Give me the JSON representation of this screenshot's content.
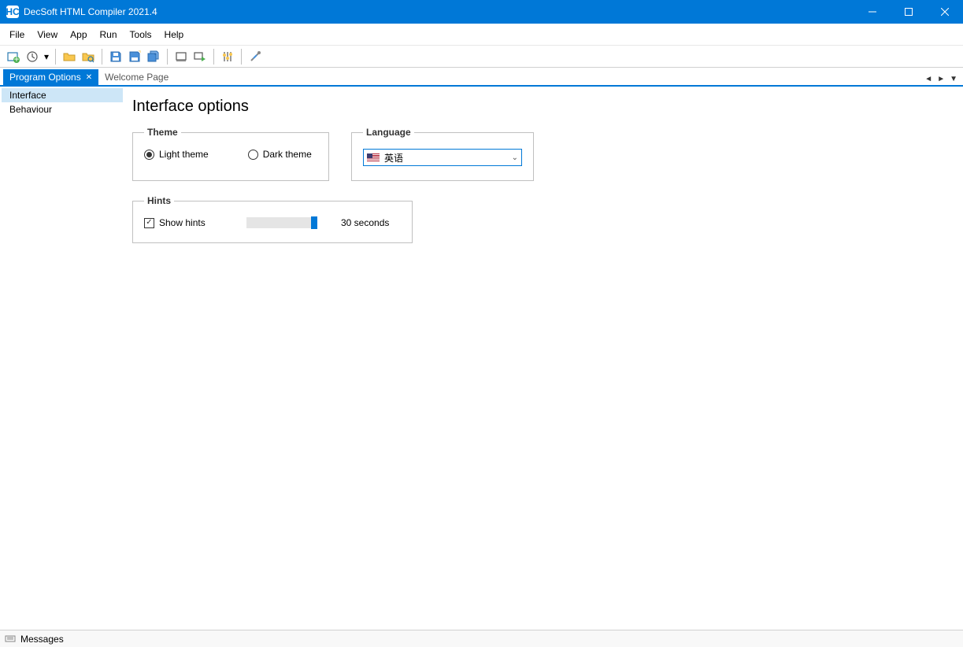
{
  "window": {
    "title": "DecSoft HTML Compiler 2021.4",
    "app_icon_text": "HC"
  },
  "menu": {
    "items": [
      "File",
      "View",
      "App",
      "Run",
      "Tools",
      "Help"
    ]
  },
  "tabs": {
    "active": {
      "label": "Program Options"
    },
    "inactive": {
      "label": "Welcome Page"
    }
  },
  "sidebar": {
    "items": [
      "Interface",
      "Behaviour"
    ],
    "selected_index": 0
  },
  "main": {
    "title": "Interface options",
    "theme": {
      "legend": "Theme",
      "light": "Light theme",
      "dark": "Dark theme"
    },
    "language": {
      "legend": "Language",
      "selected": "英语"
    },
    "hints": {
      "legend": "Hints",
      "checkbox": "Show hints",
      "value_label": "30 seconds"
    }
  },
  "statusbar": {
    "messages": "Messages"
  }
}
